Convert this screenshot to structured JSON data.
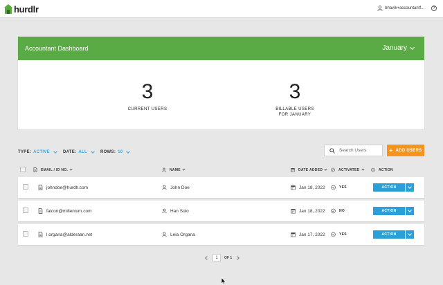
{
  "app": {
    "brand": "hurdlr",
    "user_label": "bhavik+accountantf..."
  },
  "dashboard": {
    "title": "Accountant Dashboard",
    "month": "January",
    "current_users": {
      "value": "3",
      "label": "CURRENT USERS"
    },
    "billable_users": {
      "value": "3",
      "label_line1": "BILLABLE USERS",
      "label_line2": "FOR JANUARY"
    }
  },
  "filters": {
    "type": {
      "label": "TYPE:",
      "value": "ACTIVE"
    },
    "date": {
      "label": "DATE:",
      "value": "ALL"
    },
    "rows": {
      "label": "ROWS:",
      "value": "10"
    }
  },
  "search": {
    "placeholder": "Search Users",
    "value": ""
  },
  "add_users_label": "ADD USERS",
  "table": {
    "columns": {
      "email": "EMAIL / ID NO.",
      "name": "NAME",
      "date_added": "DATE ADDED",
      "activated": "ACTIVATED",
      "action": "ACTION"
    },
    "rows": [
      {
        "email": "johndoe@hurdlr.com",
        "name": "John Doe",
        "date": "Jan 18, 2022",
        "activated": "YES",
        "action": "ACTION"
      },
      {
        "email": "falcon@millenium.com",
        "name": "Han Solo",
        "date": "Jan 18, 2022",
        "activated": "NO",
        "action": "ACTION"
      },
      {
        "email": "l.organa@alderaan.net",
        "name": "Leia Organa",
        "date": "Jan 17, 2022",
        "activated": "YES",
        "action": "ACTION"
      }
    ]
  },
  "pagination": {
    "page": "1",
    "of": "OF 1"
  },
  "colors": {
    "brand_green": "#5aab45",
    "accent_blue": "#2a9fd8",
    "accent_orange": "#f7941d"
  }
}
